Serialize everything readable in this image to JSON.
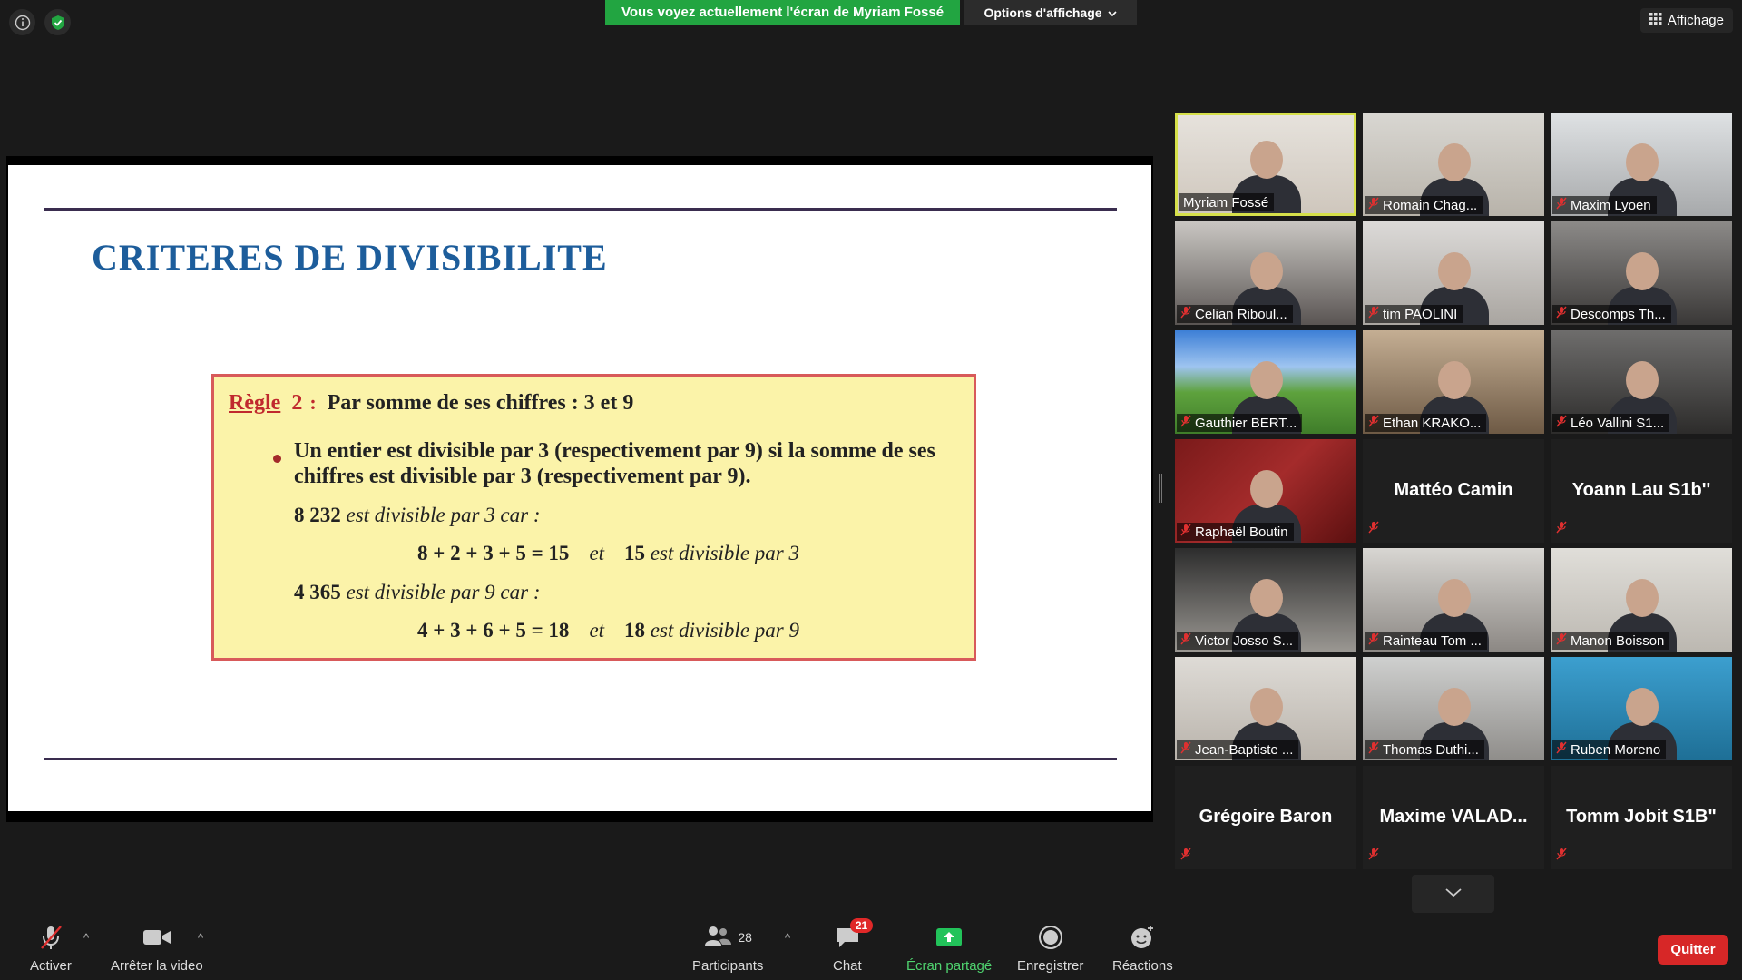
{
  "top": {
    "share_banner": "Vous voyez actuellement l'écran de Myriam Fossé",
    "view_options": "Options d'affichage",
    "layout_button": "Affichage"
  },
  "slide": {
    "title": "CRITERES DE DIVISIBILITE",
    "rule_word": "Règle",
    "rule_number": "2",
    "rule_colon": ":",
    "rule_subtitle": "Par somme de ses chiffres : 3 et 9",
    "bullet": "Un entier est divisible par 3 (respectivement par 9) si la somme de ses chiffres est divisible par 3 (respectivement par 9).",
    "ex1_number": "8 232",
    "ex1_text": "est divisible par 3 car :",
    "ex1_calc": "8 + 2 + 3 + 5 = 15",
    "ex1_and": "et",
    "ex1_result_num": "15",
    "ex1_result_text": "est divisible par 3",
    "ex2_number": "4 365",
    "ex2_text": "est divisible par 9 car :",
    "ex2_calc": "4 + 3 + 6 + 5 = 18",
    "ex2_and": "et",
    "ex2_result_num": "18",
    "ex2_result_text": "est divisible par 9"
  },
  "participants": [
    {
      "name": "Myriam Fossé",
      "video": true,
      "muted": false,
      "active": true
    },
    {
      "name": "Romain Chag...",
      "video": true,
      "muted": true
    },
    {
      "name": "Maxim Lyoen",
      "video": true,
      "muted": true
    },
    {
      "name": "Celian Riboul...",
      "video": true,
      "muted": true
    },
    {
      "name": "tim PAOLINI",
      "video": true,
      "muted": true
    },
    {
      "name": "Descomps Th...",
      "video": true,
      "muted": true
    },
    {
      "name": "Gauthier BERT...",
      "video": true,
      "muted": true
    },
    {
      "name": "Ethan KRAKO...",
      "video": true,
      "muted": true
    },
    {
      "name": "Léo Vallini S1...",
      "video": true,
      "muted": true
    },
    {
      "name": "Raphaël Boutin",
      "video": true,
      "muted": true
    },
    {
      "name": "Mattéo Camin",
      "video": false,
      "muted": true
    },
    {
      "name": "Yoann Lau S1b''",
      "video": false,
      "muted": true
    },
    {
      "name": "Victor Josso S...",
      "video": true,
      "muted": true
    },
    {
      "name": "Rainteau Tom ...",
      "video": true,
      "muted": true
    },
    {
      "name": "Manon Boisson",
      "video": true,
      "muted": true
    },
    {
      "name": "Jean-Baptiste ...",
      "video": true,
      "muted": true
    },
    {
      "name": "Thomas Duthi...",
      "video": true,
      "muted": true
    },
    {
      "name": "Ruben Moreno",
      "video": true,
      "muted": true
    },
    {
      "name": "Grégoire Baron",
      "video": false,
      "muted": true
    },
    {
      "name": "Maxime  VALAD...",
      "video": false,
      "muted": true
    },
    {
      "name": "Tomm Jobit S1B\"",
      "video": false,
      "muted": true
    }
  ],
  "toolbar": {
    "mute_label": "Activer",
    "video_label": "Arrêter la video",
    "participants_label": "Participants",
    "participants_count": "28",
    "chat_label": "Chat",
    "chat_badge": "21",
    "share_label": "Écran partagé",
    "record_label": "Enregistrer",
    "reactions_label": "Réactions",
    "quit_label": "Quitter"
  },
  "colors": {
    "share_green": "#22a541",
    "quit_red": "#d72727",
    "slide_title_blue": "#1d5d9b",
    "active_speaker_border": "#d6e04a"
  }
}
